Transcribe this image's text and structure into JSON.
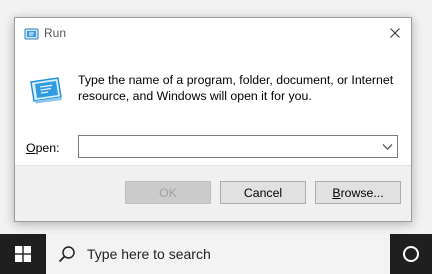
{
  "dialog": {
    "title": "Run",
    "description": "Type the name of a program, folder, document, or Internet resource, and Windows will open it for you.",
    "open_label_accel": "O",
    "open_label_rest": "pen:",
    "input_value": "",
    "ok_label": "OK",
    "cancel_label": "Cancel",
    "browse_label_accel": "B",
    "browse_label_rest": "rowse..."
  },
  "taskbar": {
    "search_placeholder": "Type here to search"
  },
  "colors": {
    "accent": "#1a8fd4",
    "taskbar": "#1f1f1f"
  }
}
